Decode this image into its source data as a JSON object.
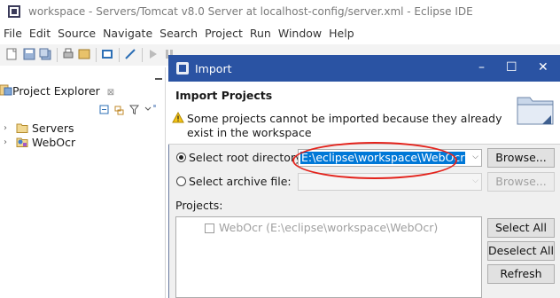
{
  "window": {
    "title": "workspace - Servers/Tomcat v8.0 Server at localhost-config/server.xml - Eclipse IDE"
  },
  "menubar": [
    "File",
    "Edit",
    "Source",
    "Navigate",
    "Search",
    "Project",
    "Run",
    "Window",
    "Help"
  ],
  "project_explorer": {
    "tab_label": "Project Explorer",
    "close_glyph": "⊠",
    "items": [
      {
        "label": "Servers",
        "icon": "folder-icon"
      },
      {
        "label": "WebOcr",
        "icon": "project-icon"
      }
    ]
  },
  "dialog": {
    "title": "Import",
    "header_title": "Import Projects",
    "warning": "Some cannot be imported because they already exist in the workspace",
    "warning_full": "Some projects cannot be imported because they already exist in the workspace",
    "root_dir_label": "Select root directory:",
    "root_dir_value": "E:\\eclipse\\workspace\\WebOcr",
    "archive_label": "Select archive file:",
    "browse_label": "Browse...",
    "browse2_label": "Browse...",
    "projects_label": "Projects:",
    "project_items": [
      {
        "label": "WebOcr (E:\\eclipse\\workspace\\WebOcr)",
        "checked": false,
        "disabled": true
      }
    ],
    "select_all": "Select All",
    "deselect_all": "Deselect All",
    "refresh": "Refresh",
    "root_selected": true,
    "archive_selected": false
  },
  "colors": {
    "dialog_title_bg": "#2a53a3",
    "selection": "#0078d7",
    "annotation": "#e3231c"
  }
}
